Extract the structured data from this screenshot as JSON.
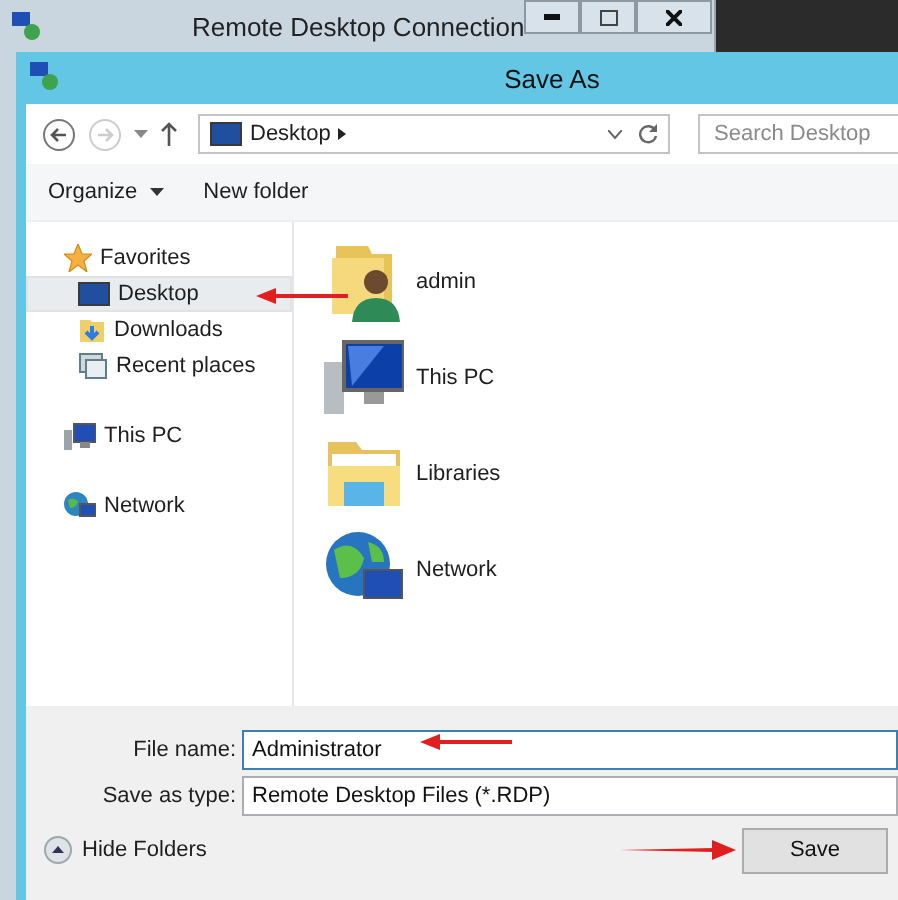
{
  "background_window": {
    "title": "Remote Desktop Connection"
  },
  "window": {
    "title": "Save As"
  },
  "address_bar": {
    "location": "Desktop"
  },
  "search": {
    "placeholder": "Search Desktop"
  },
  "command_bar": {
    "organize": "Organize",
    "new_folder": "New folder"
  },
  "sidebar": {
    "items": [
      {
        "label": "Favorites",
        "kind": "favorites",
        "selected": false,
        "children": [
          {
            "label": "Desktop",
            "kind": "desktop",
            "selected": true,
            "pointer_arrow": true
          },
          {
            "label": "Downloads",
            "kind": "downloads",
            "selected": false
          },
          {
            "label": "Recent places",
            "kind": "recent",
            "selected": false
          }
        ]
      },
      {
        "label": "This PC",
        "kind": "pc",
        "selected": false
      },
      {
        "label": "Network",
        "kind": "network",
        "selected": false
      }
    ]
  },
  "content": {
    "items": [
      {
        "label": "admin",
        "kind": "user"
      },
      {
        "label": "This PC",
        "kind": "pc"
      },
      {
        "label": "Libraries",
        "kind": "libraries"
      },
      {
        "label": "Network",
        "kind": "network"
      }
    ]
  },
  "file_name": {
    "label": "File name:",
    "value": "Administrator",
    "pointer_arrow": true
  },
  "save_as_type": {
    "label": "Save as type:",
    "value": "Remote Desktop Files (*.RDP)"
  },
  "hide_folders": "Hide Folders",
  "save_button": {
    "label": "Save",
    "pointer_arrow": true
  }
}
